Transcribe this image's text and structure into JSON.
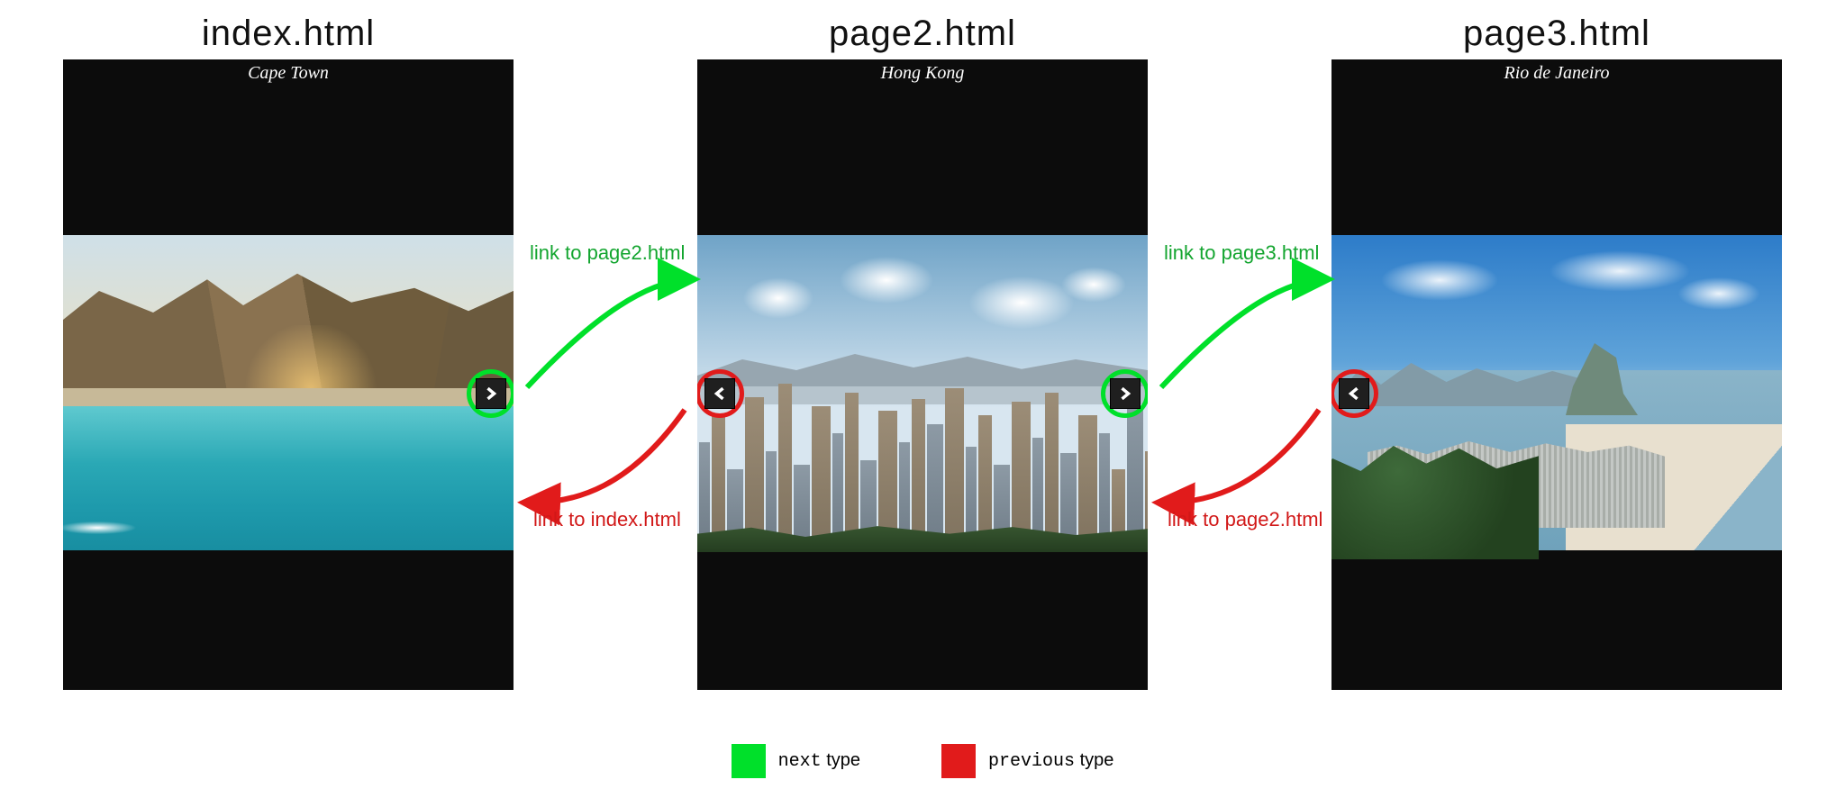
{
  "pages": [
    {
      "filename": "index.html",
      "title": "Cape Town",
      "next_target": "page2.html",
      "prev_target": null
    },
    {
      "filename": "page2.html",
      "title": "Hong Kong",
      "next_target": "page3.html",
      "prev_target": "index.html"
    },
    {
      "filename": "page3.html",
      "title": "Rio de Janeiro",
      "next_target": null,
      "prev_target": "page2.html"
    }
  ],
  "connections": {
    "next12_label": "link to page2.html",
    "prev21_label": "link to index.html",
    "next23_label": "link to page3.html",
    "prev32_label": "link to page2.html"
  },
  "legend": {
    "next_label_code": "next",
    "next_label_suffix": " type",
    "prev_label_code": "previous",
    "prev_label_suffix": " type"
  },
  "colors": {
    "next_green": "#00e02a",
    "prev_red": "#e11b1b"
  }
}
